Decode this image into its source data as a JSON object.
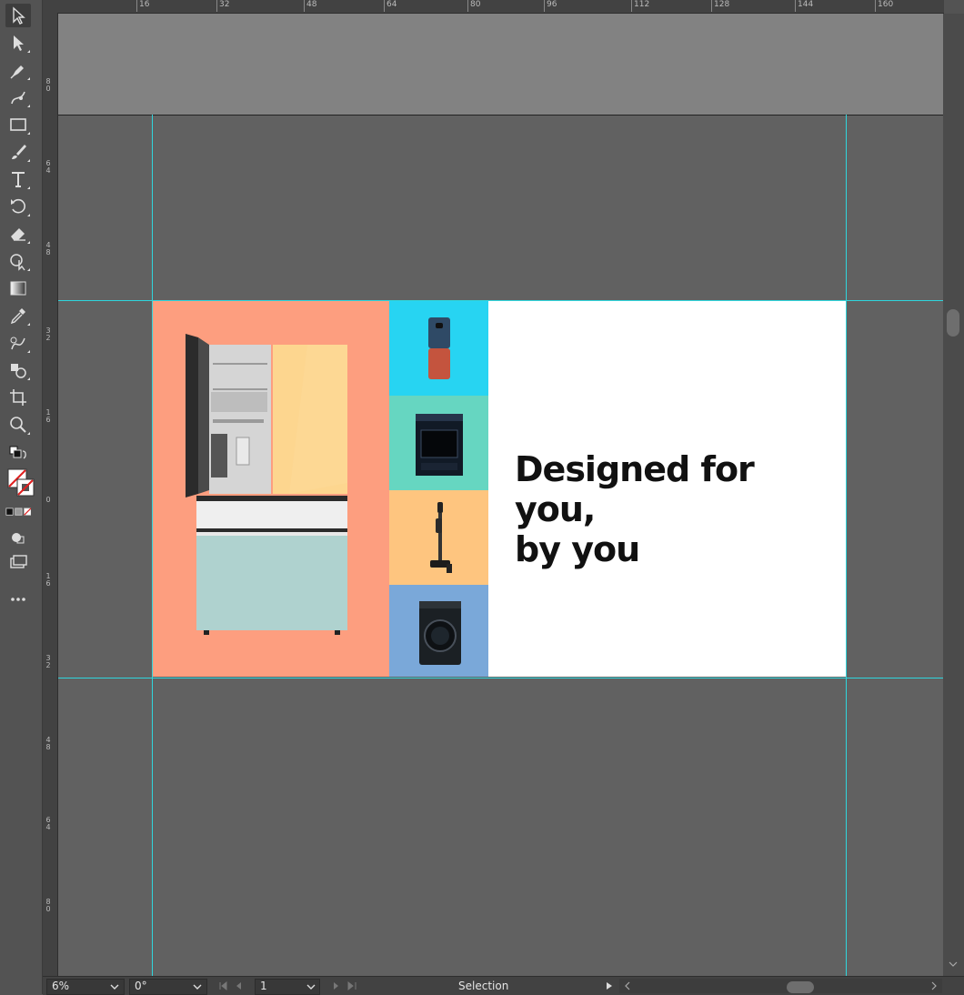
{
  "ruler": {
    "top_labels": [
      "16",
      "32",
      "48",
      "64",
      "80",
      "96",
      "112",
      "128",
      "144",
      "160"
    ],
    "left_labels": [
      "80",
      "64",
      "48",
      "32",
      "16",
      "0",
      "16",
      "32",
      "48",
      "64",
      "80"
    ]
  },
  "artboard": {
    "headline_line1": "Designed for you,",
    "headline_line2": "by you",
    "colors": {
      "fridge_panel": "#fd9e7f",
      "tile_phone": "#27d4f2",
      "tile_range": "#66d6c1",
      "tile_vacuum": "#fec57f",
      "tile_washer": "#7aa8d9"
    },
    "products": [
      "flip-phone",
      "oven-range",
      "stick-vacuum",
      "washing-machine",
      "refrigerator"
    ]
  },
  "status_bar": {
    "zoom": "6%",
    "rotation": "0°",
    "artboard_number": "1",
    "current_tool": "Selection"
  },
  "tools": [
    "selection-tool",
    "direct-selection-tool",
    "pen-tool",
    "curvature-tool",
    "rectangle-tool",
    "paintbrush-tool",
    "type-tool",
    "rotate-tool",
    "eraser-tool",
    "shape-builder-tool",
    "gradient-tool",
    "eyedropper-tool",
    "blend-tool",
    "symbol-sprayer-tool",
    "artboard-tool",
    "zoom-tool",
    "edit-toolbar"
  ]
}
